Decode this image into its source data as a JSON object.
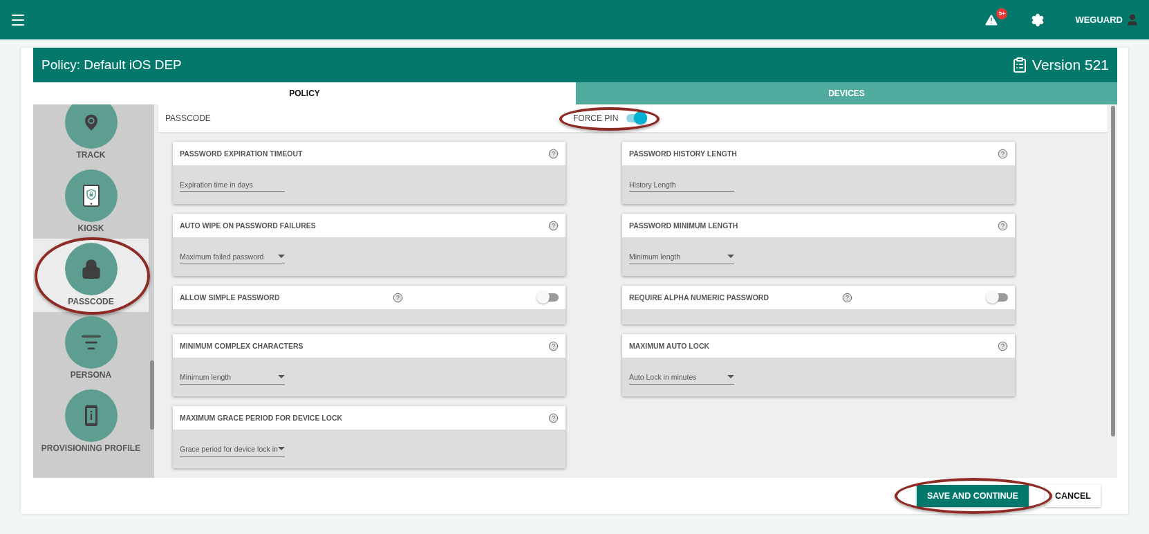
{
  "top_bar": {
    "alert_badge": "5+",
    "user_name": "WEGUARD"
  },
  "policy": {
    "title": "Policy: Default iOS DEP",
    "version": "Version 521"
  },
  "tabs": [
    {
      "label": "POLICY",
      "selected": true
    },
    {
      "label": "DEVICES",
      "selected": false
    }
  ],
  "sidebar": {
    "items": [
      {
        "label": "TRACK",
        "kind": "pin",
        "selected": false,
        "circled": false
      },
      {
        "label": "KIOSK",
        "kind": "tablet",
        "selected": false,
        "circled": false
      },
      {
        "label": "PASSCODE",
        "kind": "lock",
        "selected": true,
        "circled": true
      },
      {
        "label": "PERSONA",
        "kind": "filter",
        "selected": false,
        "circled": false
      },
      {
        "label": "PROVISIONING PROFILE",
        "kind": "phone",
        "selected": false,
        "circled": false
      }
    ]
  },
  "section": {
    "title": "PASSCODE",
    "force_pin": {
      "label": "FORCE PIN",
      "on": true,
      "circled": true
    }
  },
  "settings": [
    {
      "title": "PASSWORD EXPIRATION TIMEOUT",
      "kind": "text",
      "placeholder": "Expiration time in days"
    },
    {
      "title": "PASSWORD HISTORY LENGTH",
      "kind": "text",
      "placeholder": "History Length"
    },
    {
      "title": "AUTO WIPE ON PASSWORD FAILURES",
      "kind": "select",
      "placeholder": "Maximum failed password"
    },
    {
      "title": "PASSWORD MINIMUM LENGTH",
      "kind": "select",
      "placeholder": "Minimum length"
    },
    {
      "title": "ALLOW SIMPLE PASSWORD",
      "kind": "toggle",
      "on": false
    },
    {
      "title": "REQUIRE ALPHA NUMERIC PASSWORD",
      "kind": "toggle",
      "on": false
    },
    {
      "title": "MINIMUM COMPLEX CHARACTERS",
      "kind": "select",
      "placeholder": "Minimum length"
    },
    {
      "title": "MAXIMUM AUTO LOCK",
      "kind": "select",
      "placeholder": "Auto Lock in minutes"
    },
    {
      "title": "MAXIMUM GRACE PERIOD FOR DEVICE LOCK",
      "kind": "select",
      "placeholder": "Grace period for device lock in"
    }
  ],
  "actions": {
    "save": {
      "label": "SAVE AND CONTINUE",
      "circled": true
    },
    "cancel": "CANCEL"
  }
}
